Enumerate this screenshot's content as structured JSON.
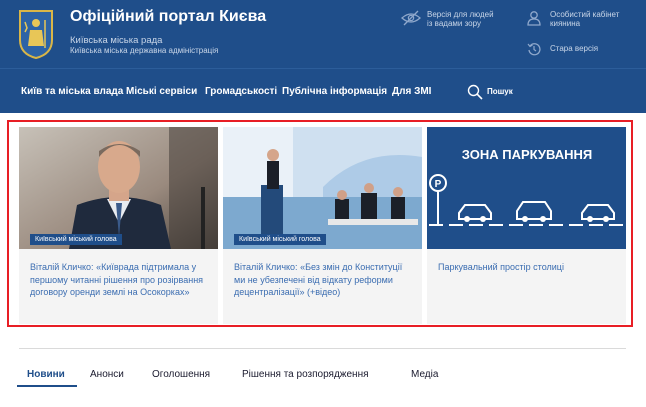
{
  "header": {
    "title": "Офіційний портал Києва",
    "subtitle1": "Київська міська рада",
    "subtitle2": "Київська міська державна адміністрація",
    "vision_label_1": "Версія для людей",
    "vision_label_2": "із вадами зору",
    "cabinet_label_1": "Особистий кабінет",
    "cabinet_label_2": "киянина",
    "old_version": "Стара версія",
    "icons": {
      "logo": "kyiv-coat-of-arms",
      "vision": "eye-slash-icon",
      "cabinet": "user-icon",
      "old": "history-icon",
      "search": "search-icon"
    }
  },
  "nav": {
    "items": [
      {
        "label": "Київ та міська влада"
      },
      {
        "label": "Міські сервіси"
      },
      {
        "label": "Громадськості"
      },
      {
        "label": "Публічна інформація"
      },
      {
        "label": "Для ЗМІ"
      }
    ],
    "search_label": "Пошук"
  },
  "cards": [
    {
      "badge": "Київський міський голова",
      "title": "Віталій Кличко: «Київрада підтримала у першому читанні рішення про розірвання договору оренди землі на Осокорках»"
    },
    {
      "badge": "Київський міський голова",
      "title": "Віталій Кличко: «Без змін до Конституції ми не убезпечені від відкату реформи децентралізації» (+відео)"
    },
    {
      "badge": "",
      "title": "Паркувальний простір столиці",
      "image_text": "ЗОНА ПАРКУВАННЯ"
    }
  ],
  "tabs": [
    {
      "label": "Новини",
      "active": true
    },
    {
      "label": "Анонси"
    },
    {
      "label": "Оголошення"
    },
    {
      "label": "Рішення та розпорядження"
    },
    {
      "label": "Медіа"
    }
  ],
  "colors": {
    "brand_blue": "#1f4e8a",
    "link_blue": "#3b6db1",
    "highlight_red": "#e81e25",
    "card_bg": "#f4f4f4"
  }
}
